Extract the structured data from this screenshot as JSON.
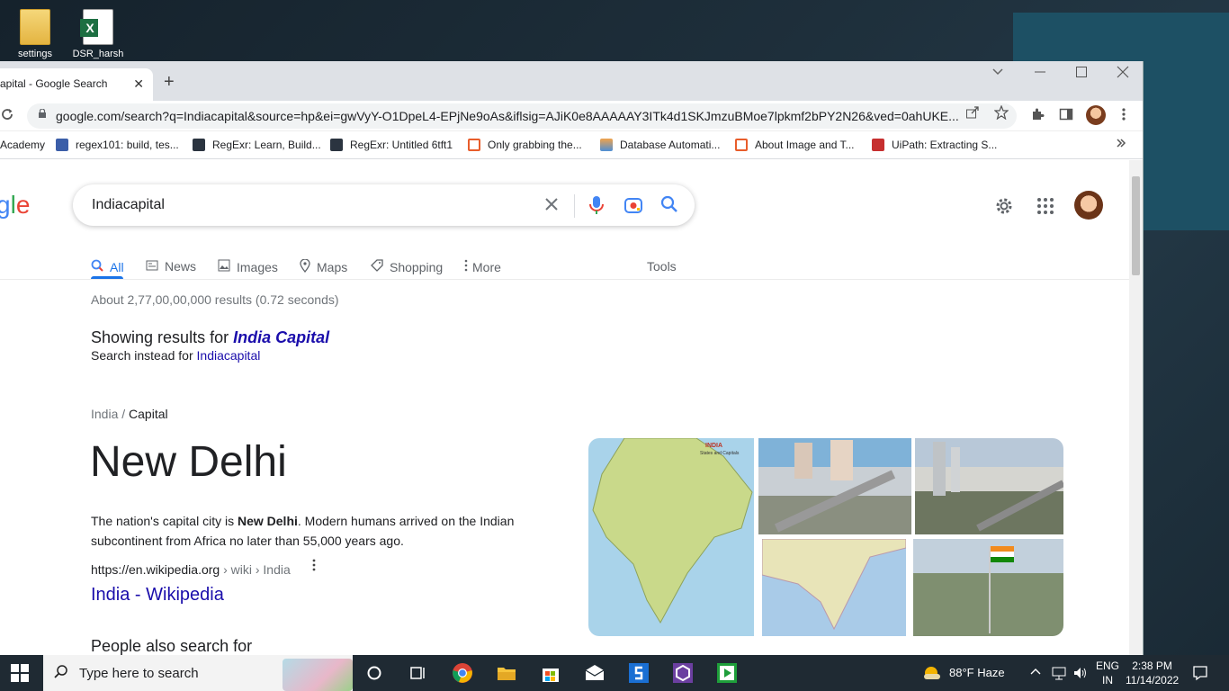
{
  "desktop": {
    "icons": [
      {
        "label": "settings"
      },
      {
        "label": "DSR_harsh"
      }
    ]
  },
  "browser": {
    "tab_title": "apital - Google Search",
    "tab_close": "✕",
    "new_tab": "+",
    "address": "google.com/search?q=Indiacapital&source=hp&ei=gwVyY-O1DpeL4-EPjNe9oAs&iflsig=AJiK0e8AAAAAY3ITk4d1SKJmzuBMoe7lpkmf2bPY2N26&ved=0ahUKE...",
    "bookmarks": [
      {
        "label": "Academy"
      },
      {
        "label": "regex101: build, tes..."
      },
      {
        "label": "RegExr: Learn, Build..."
      },
      {
        "label": "RegExr: Untitled 6tft1"
      },
      {
        "label": "Only grabbing the..."
      },
      {
        "label": "Database Automati..."
      },
      {
        "label": "About Image and T..."
      },
      {
        "label": "UiPath: Extracting S..."
      }
    ]
  },
  "google": {
    "logo_fragment": "gle",
    "query": "Indiacapital",
    "nav_tabs": [
      {
        "label": "All"
      },
      {
        "label": "News"
      },
      {
        "label": "Images"
      },
      {
        "label": "Maps"
      },
      {
        "label": "Shopping"
      },
      {
        "label": "More"
      },
      {
        "label": "Tools"
      }
    ],
    "stats": "About 2,77,00,00,000 results (0.72 seconds)",
    "showing_prefix": "Showing results for",
    "showing_term": "India Capital",
    "instead_prefix": "Search instead for",
    "instead_term": "Indiacapital",
    "breadcrumb": {
      "parent": "India",
      "sep": "/",
      "current": "Capital"
    },
    "answer": "New Delhi",
    "desc_prefix": "The nation's capital city is",
    "desc_bold": "New Delhi",
    "desc_suffix": ". Modern humans arrived on the Indian subcontinent from Africa no later than 55,000 years ago.",
    "cite_url": "https://en.wikipedia.org",
    "cite_path": " › wiki › India",
    "wiki_link": "India - Wikipedia",
    "people_also": "People also search for",
    "map_title": "INDIA",
    "map_subtitle": "States and Capitals"
  },
  "taskbar": {
    "search_placeholder": "Type here to search",
    "weather": "88°F  Haze",
    "lang_top": "ENG",
    "lang_bottom": "IN",
    "time": "2:38 PM",
    "date": "11/14/2022"
  },
  "colors": {
    "link": "#1a0dab",
    "accent": "#1a73e8",
    "taskbar": "#1f2a33"
  }
}
